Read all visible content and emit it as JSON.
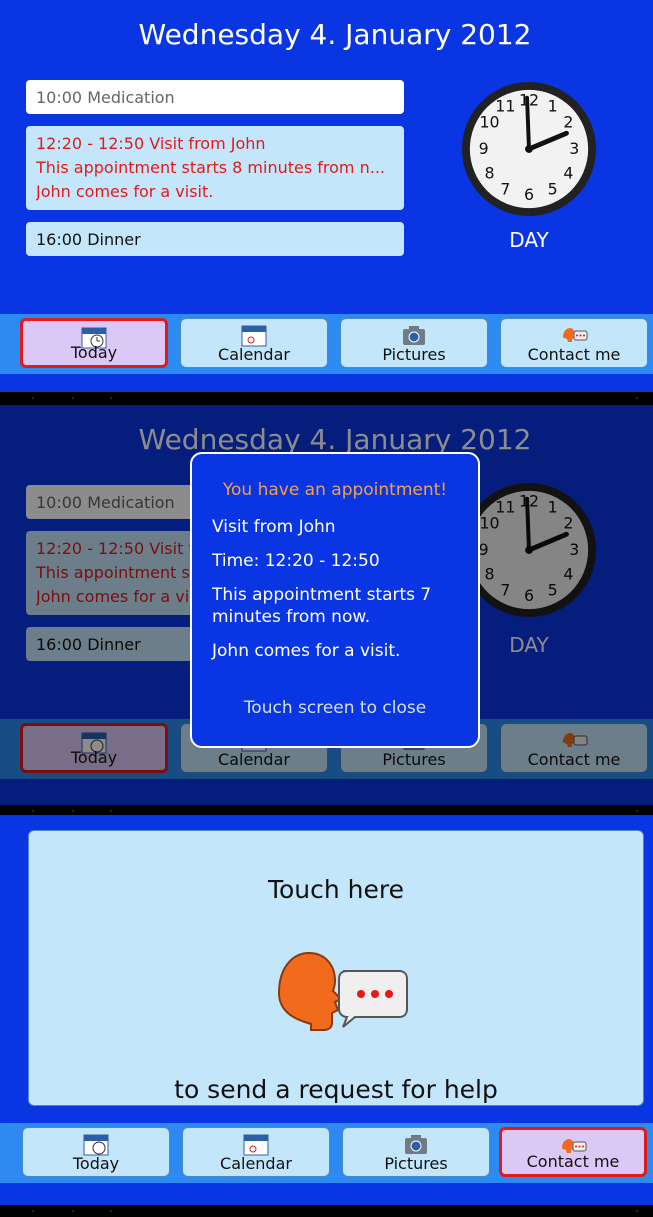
{
  "date_title": "Wednesday 4. January 2012",
  "appointments": [
    {
      "text": "10:00  Medication"
    },
    {
      "line1": "12:20 - 12:50  Visit from John",
      "line2": "This appointment starts 8 minutes from n...",
      "line3": "John comes for a visit."
    },
    {
      "text": "16:00  Dinner"
    }
  ],
  "day_label": "DAY",
  "nav": [
    {
      "label": "Today",
      "icon": "clock-calendar-icon"
    },
    {
      "label": "Calendar",
      "icon": "calendar-icon"
    },
    {
      "label": "Pictures",
      "icon": "camera-icon"
    },
    {
      "label": "Contact me",
      "icon": "speech-bubble-icon"
    }
  ],
  "modal": {
    "title": "You have an appointment!",
    "visit": "Visit from John",
    "time": "Time: 12:20 - 12:50",
    "starts": "This appointment starts 7 minutes from now.",
    "note": "John comes for a visit.",
    "close": "Touch screen to close"
  },
  "help": {
    "top": "Touch here",
    "bottom": "to send a request for help"
  },
  "colors": {
    "background": "#0a35e2",
    "card": "#c3e6fb",
    "active": "#dcc8f7",
    "alert": "#e21a1a",
    "modal_title": "#f7a040"
  }
}
